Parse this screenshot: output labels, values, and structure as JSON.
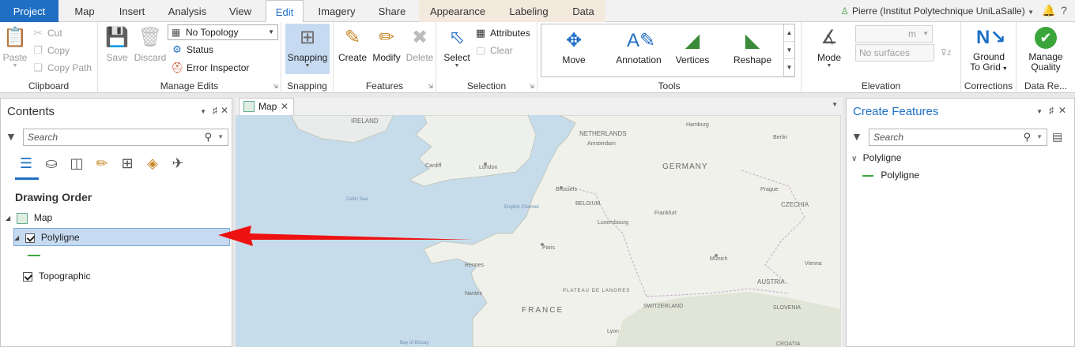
{
  "tabs": {
    "project": "Project",
    "map": "Map",
    "insert": "Insert",
    "analysis": "Analysis",
    "view": "View",
    "edit": "Edit",
    "imagery": "Imagery",
    "share": "Share",
    "appearance": "Appearance",
    "labeling": "Labeling",
    "data": "Data"
  },
  "user": "Pierre (Institut Polytechnique UniLaSalle)",
  "ribbon": {
    "clipboard": {
      "label": "Clipboard",
      "paste": "Paste",
      "cut": "Cut",
      "copy": "Copy",
      "copy_path": "Copy Path"
    },
    "manage_edits": {
      "label": "Manage Edits",
      "save": "Save",
      "discard": "Discard",
      "topology": "No Topology",
      "status": "Status",
      "error_inspector": "Error Inspector"
    },
    "snapping": {
      "label": "Snapping",
      "button": "Snapping"
    },
    "features": {
      "label": "Features",
      "create": "Create",
      "modify": "Modify",
      "delete": "Delete"
    },
    "selection": {
      "label": "Selection",
      "select": "Select",
      "attributes": "Attributes",
      "clear": "Clear"
    },
    "tools": {
      "label": "Tools",
      "move": "Move",
      "annotation": "Annotation",
      "vertices": "Vertices",
      "reshape": "Reshape"
    },
    "elevation": {
      "label": "Elevation",
      "mode": "Mode",
      "surfaces": "No surfaces",
      "unit": "m"
    },
    "corrections": {
      "label": "Corrections",
      "ground": "Ground",
      "to_grid": "To Grid"
    },
    "data_reviewer": {
      "label": "Data Re...",
      "manage": "Manage",
      "quality": "Quality"
    }
  },
  "contents": {
    "title": "Contents",
    "search_placeholder": "Search",
    "drawing_order": "Drawing Order",
    "map_item": "Map",
    "layer_polyligne": "Polyligne",
    "layer_topographic": "Topographic"
  },
  "map_view": {
    "tab": "Map",
    "labels": {
      "ireland": "IRELAND",
      "netherlands": "NETHERLANDS",
      "amsterdam": "Amsterdam",
      "germany": "GERMANY",
      "belgium": "BELGIUM",
      "brussels": "Brussels",
      "london": "London",
      "cardiff": "Cardiff",
      "luxembourg": "Luxembourg",
      "paris": "Paris",
      "france": "FRANCE",
      "czechia": "CZECHIA",
      "prague": "Prague",
      "austria": "AUSTRIA",
      "vienna": "Vienna",
      "munich": "Munich",
      "switzerland": "SWITZERLAND",
      "slovenia": "SLOVENIA",
      "croatia": "CROATIA",
      "english_channel": "English Channel",
      "celtic_sea": "Celtic Sea",
      "nantes": "Nantes",
      "rennes": "Rennes",
      "lyon": "Lyon",
      "berlin": "Berlin",
      "hamburg": "Hamburg",
      "frankfurt": "Frankfurt",
      "plateau": "PLATEAU DE LANGRES",
      "bay_of_biscay": "Bay of Biscay"
    }
  },
  "create_features": {
    "title": "Create Features",
    "search_placeholder": "Search",
    "group": "Polyligne",
    "template": "Polyligne"
  },
  "colors": {
    "accent": "#1f6fc5",
    "selection": "#c6dbf1",
    "arrow": "#ee1111",
    "polyline": "#3aa63a"
  }
}
